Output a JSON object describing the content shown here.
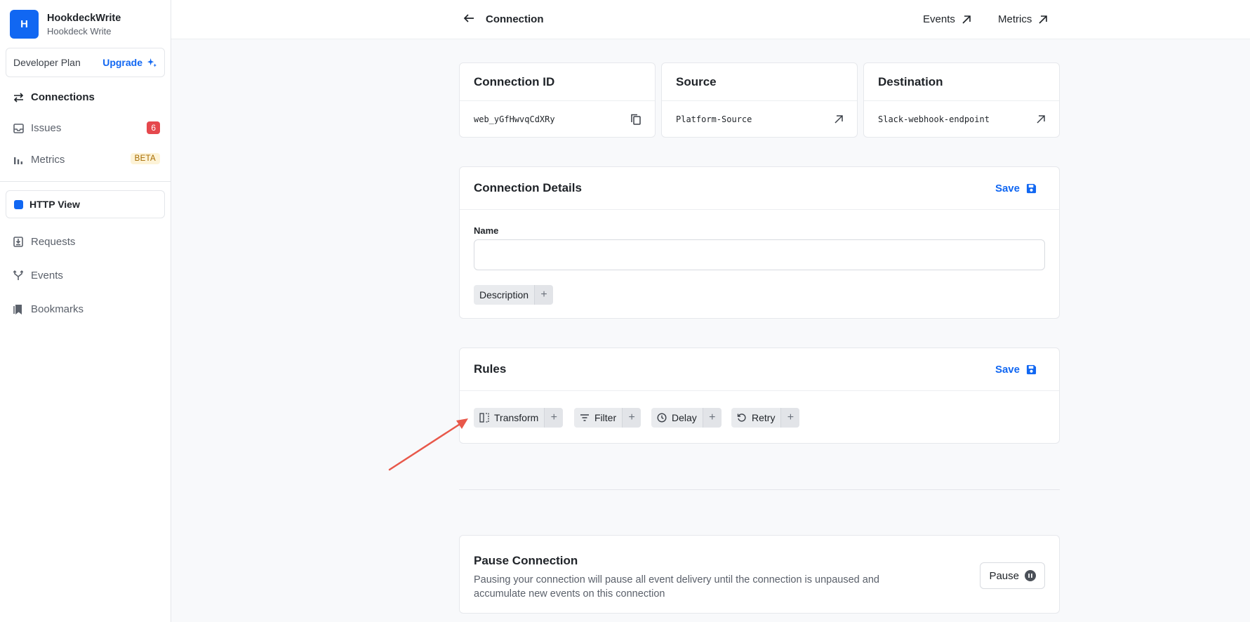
{
  "workspace": {
    "initial": "H",
    "name": "HookdeckWrite",
    "subtitle": "Hookdeck Write"
  },
  "plan": {
    "label": "Developer Plan",
    "upgrade_label": "Upgrade"
  },
  "nav": {
    "connections": "Connections",
    "issues": "Issues",
    "issues_count": "6",
    "metrics": "Metrics",
    "metrics_badge": "BETA",
    "view_label": "HTTP View",
    "requests": "Requests",
    "events": "Events",
    "bookmarks": "Bookmarks"
  },
  "header": {
    "title": "Connection",
    "events_link": "Events",
    "metrics_link": "Metrics"
  },
  "info_cards": {
    "connection_id": {
      "title": "Connection ID",
      "value": "web_yGfHwvqCdXRy",
      "action_icon": "copy-icon"
    },
    "source": {
      "title": "Source",
      "value": "Platform-Source",
      "action_icon": "external-link-icon"
    },
    "destination": {
      "title": "Destination",
      "value": "Slack-webhook-endpoint",
      "action_icon": "external-link-icon"
    }
  },
  "details": {
    "title": "Connection Details",
    "save_label": "Save",
    "name_label": "Name",
    "name_value": "",
    "description_chip": "Description"
  },
  "rules": {
    "title": "Rules",
    "save_label": "Save",
    "items": [
      "Transform",
      "Filter",
      "Delay",
      "Retry"
    ]
  },
  "pause": {
    "title": "Pause Connection",
    "description": "Pausing your connection will pause all event delivery until the connection is unpaused and accumulate new events on this connection",
    "button_label": "Pause"
  },
  "colors": {
    "accent": "#1167f2",
    "issue_badge": "#e5484d",
    "annotation_arrow": "#e8584a"
  }
}
